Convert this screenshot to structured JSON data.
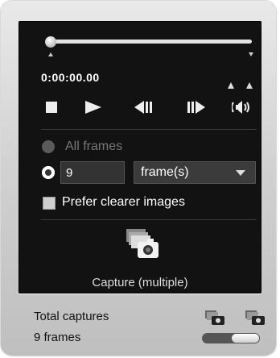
{
  "player": {
    "timecode": "0:00:00.00",
    "position": 0
  },
  "capture_options": {
    "all_frames_label": "All frames",
    "count_value": "9",
    "unit_select": "frame(s)",
    "prefer_clearer_label": "Prefer clearer images",
    "prefer_clearer_checked": false,
    "capture_button_label": "Capture (multiple)"
  },
  "footer": {
    "total_captures_label": "Total captures",
    "count_label": "9 frames"
  },
  "icons": {
    "stop": "stop-icon",
    "play": "play-icon",
    "prev_frame": "previous-frame-icon",
    "next_frame": "next-frame-icon",
    "volume": "volume-icon",
    "camera": "camera-capture-icon"
  }
}
